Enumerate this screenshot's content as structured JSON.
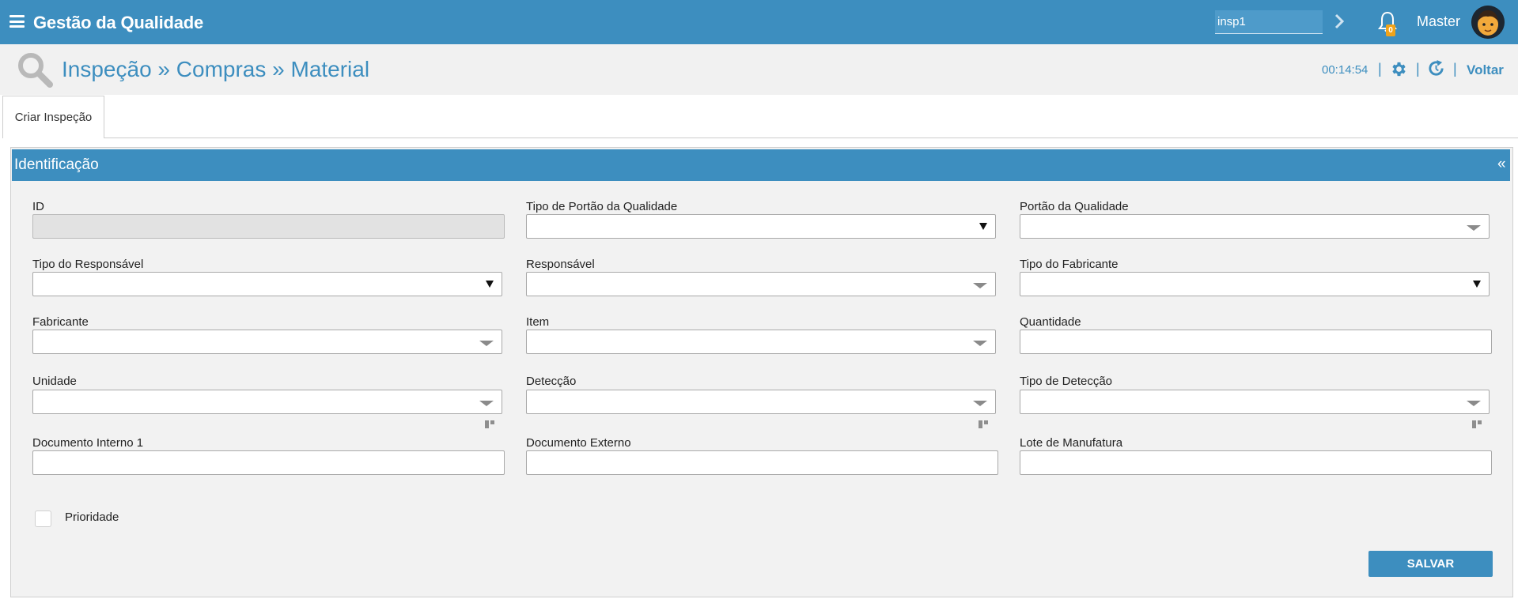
{
  "app": {
    "title": "Gestão da Qualidade"
  },
  "header": {
    "search_value": "insp1",
    "notifications_count": "0",
    "user_name": "Master"
  },
  "breadcrumb": {
    "text": "Inspeção » Compras » Material"
  },
  "toolbar": {
    "timer": "00:14:54",
    "back_label": "Voltar",
    "separator": "|"
  },
  "tabs": [
    {
      "label": "Criar Inspeção",
      "active": true
    }
  ],
  "panel": {
    "title": "Identificação",
    "collapse_glyph": "«",
    "fields": {
      "id": {
        "label": "ID",
        "value": ""
      },
      "tipo_portao": {
        "label": "Tipo de Portão da Qualidade",
        "value": ""
      },
      "portao": {
        "label": "Portão da Qualidade",
        "value": ""
      },
      "tipo_responsavel": {
        "label": "Tipo do Responsável",
        "value": ""
      },
      "responsavel": {
        "label": "Responsável",
        "value": ""
      },
      "tipo_fabricante": {
        "label": "Tipo do Fabricante",
        "value": ""
      },
      "fabricante": {
        "label": "Fabricante",
        "value": ""
      },
      "item": {
        "label": "Item",
        "value": ""
      },
      "quantidade": {
        "label": "Quantidade",
        "value": ""
      },
      "unidade": {
        "label": "Unidade",
        "value": ""
      },
      "deteccao": {
        "label": "Detecção",
        "value": ""
      },
      "tipo_deteccao": {
        "label": "Tipo de Detecção",
        "value": ""
      },
      "doc_interno": {
        "label": "Documento Interno 1",
        "value": ""
      },
      "doc_externo": {
        "label": "Documento Externo",
        "value": ""
      },
      "lote": {
        "label": "Lote de Manufatura",
        "value": ""
      }
    },
    "prioridade": {
      "label": "Prioridade",
      "checked": false
    },
    "save_label": "SALVAR"
  },
  "colors": {
    "primary": "#3d8ebf",
    "badge": "#f0a319",
    "panel_bg": "#f2f2f2"
  },
  "icons": [
    "hamburger-icon",
    "chevron-right-icon",
    "bell-icon",
    "avatar",
    "magnifier-icon",
    "gear-icon",
    "refresh-icon",
    "more-dots-icon"
  ]
}
